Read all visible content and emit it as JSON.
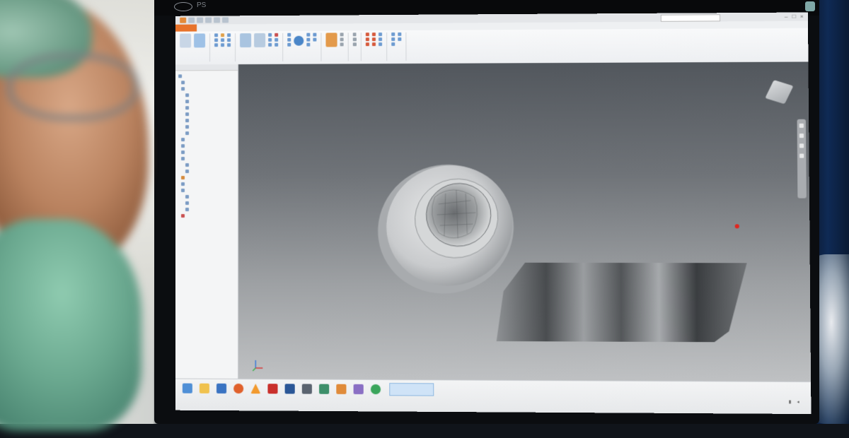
{
  "scene": {
    "description_tags": [
      "person-foreground",
      "monitor",
      "cad-application"
    ]
  },
  "monitor": {
    "brand_text": "PS"
  },
  "app": {
    "window_title": "",
    "ribbon_tabs": [
      "",
      "",
      "",
      "",
      "",
      "",
      "",
      "",
      "",
      ""
    ],
    "taskbar_label": ""
  },
  "colors": {
    "file_tab": "#e8732b",
    "accent": "#1a5fb4",
    "viewport_top": "#52575d",
    "viewport_bottom": "#bfc1c3",
    "marker_red": "#e0261f",
    "mask_green": "#6aa88f"
  },
  "icons": {
    "quick_access": [
      "new-icon",
      "open-icon",
      "save-icon",
      "undo-icon",
      "redo-icon"
    ],
    "taskbar": [
      "windows-start-icon",
      "folder-icon",
      "media-icon",
      "firefox-icon",
      "cone-icon",
      "autodesk-icon",
      "word-icon",
      "vmware-icon",
      "app-icon",
      "app-icon",
      "photos-icon",
      "chrome-icon"
    ]
  }
}
